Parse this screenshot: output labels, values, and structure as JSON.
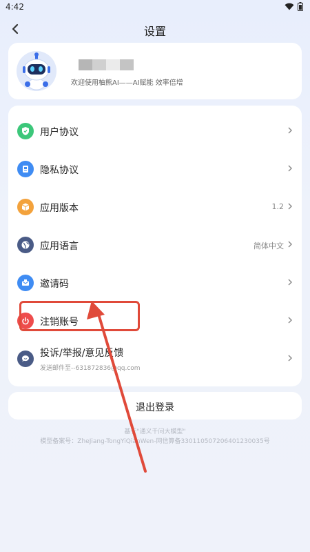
{
  "status_bar": {
    "time": "4:42",
    "wifi_icon": "wifi-icon",
    "battery_icon": "battery-icon"
  },
  "header": {
    "title": "设置",
    "back_icon": "chevron-left-icon"
  },
  "profile": {
    "welcome": "欢迎使用柚熊AI——AI赋能 效率倍增",
    "avatar_icon": "robot-avatar-icon"
  },
  "menu": {
    "items": [
      {
        "label": "用户协议",
        "value": "",
        "icon": "shield-icon",
        "color": "#3cc77a"
      },
      {
        "label": "隐私协议",
        "value": "",
        "icon": "document-icon",
        "color": "#3f8cf3"
      },
      {
        "label": "应用版本",
        "value": "1.2",
        "icon": "box-icon",
        "color": "#f3a23c"
      },
      {
        "label": "应用语言",
        "value": "简体中文",
        "icon": "globe-icon",
        "color": "#4a5b86"
      },
      {
        "label": "邀请码",
        "value": "",
        "icon": "envelope-icon",
        "color": "#3f8cf3"
      },
      {
        "label": "注销账号",
        "value": "",
        "icon": "power-icon",
        "color": "#ee4c4c"
      },
      {
        "label": "投诉/举报/意见反馈",
        "sub": "发送邮件至--631872836@qq.com",
        "value": "",
        "icon": "chat-icon",
        "color": "#4a5b86"
      }
    ]
  },
  "logout": {
    "label": "退出登录"
  },
  "footer": {
    "line1": "基于\"通义千问大模型\"",
    "line2": "模型备案号：ZheJiang-TongYiQianWen-网信算备330110507206401230035号"
  },
  "annotation": {
    "color": "#e04a3a"
  }
}
